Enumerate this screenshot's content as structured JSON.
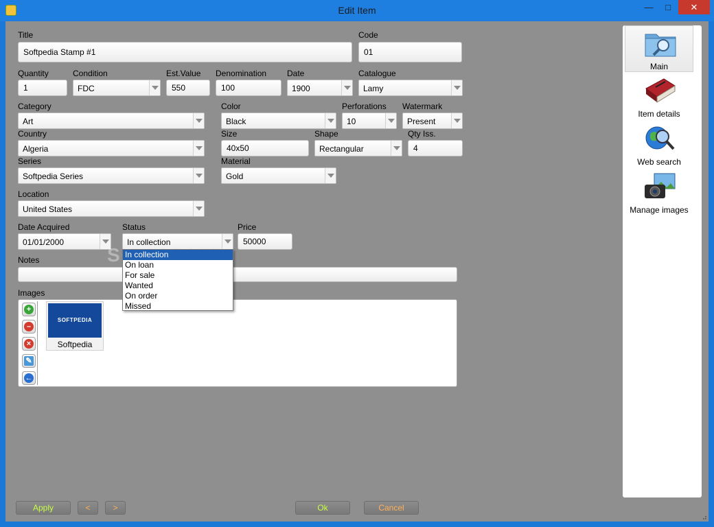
{
  "window": {
    "title": "Edit Item"
  },
  "form": {
    "title_label": "Title",
    "title_value": "Softpedia Stamp #1",
    "code_label": "Code",
    "code_value": "01",
    "quantity_label": "Quantity",
    "quantity_value": "1",
    "condition_label": "Condition",
    "condition_value": "FDC",
    "estvalue_label": "Est.Value",
    "estvalue_value": "550",
    "denomination_label": "Denomination",
    "denomination_value": "100",
    "date_label": "Date",
    "date_value": "1900",
    "catalogue_label": "Catalogue",
    "catalogue_value": "Lamy",
    "category_label": "Category",
    "category_value": "Art",
    "color_label": "Color",
    "color_value": "Black",
    "perforations_label": "Perforations",
    "perforations_value": "10",
    "watermark_label": "Watermark",
    "watermark_value": "Present",
    "country_label": "Country",
    "country_value": "Algeria",
    "size_label": "Size",
    "size_value": "40x50",
    "shape_label": "Shape",
    "shape_value": "Rectangular",
    "qtyiss_label": "Qty Iss.",
    "qtyiss_value": "4",
    "series_label": "Series",
    "series_value": "Softpedia Series",
    "material_label": "Material",
    "material_value": "Gold",
    "location_label": "Location",
    "location_value": "United States",
    "dateacq_label": "Date Acquired",
    "dateacq_value": "01/01/2000",
    "status_label": "Status",
    "status_value": "In collection",
    "price_label": "Price",
    "price_value": "50000",
    "notes_label": "Notes",
    "notes_value": "",
    "images_label": "Images"
  },
  "status_options": [
    "In collection",
    "On loan",
    "For sale",
    "Wanted",
    "On order",
    "Missed"
  ],
  "watermark_text": "SOFTPEDIA",
  "images": [
    {
      "caption": "Softpedia",
      "logo_text": "SOFTPEDIA"
    }
  ],
  "image_tools": [
    "add-icon",
    "remove-icon",
    "delete-icon",
    "edit-icon",
    "back-icon"
  ],
  "nav": [
    {
      "label": "Main",
      "icon": "folder-search-icon"
    },
    {
      "label": "Item details",
      "icon": "book-icon"
    },
    {
      "label": "Web search",
      "icon": "globe-search-icon"
    },
    {
      "label": "Manage images",
      "icon": "camera-icon"
    }
  ],
  "buttons": {
    "apply": "Apply",
    "prev": "<",
    "next": ">",
    "ok": "Ok",
    "cancel": "Cancel"
  },
  "colors": {
    "apply_text": "#c8ff45",
    "ok_text": "#c8ff45",
    "cancel_text": "#ffb15a",
    "nav_text": "#c8ff45",
    "selection": "#1f5fb4"
  }
}
